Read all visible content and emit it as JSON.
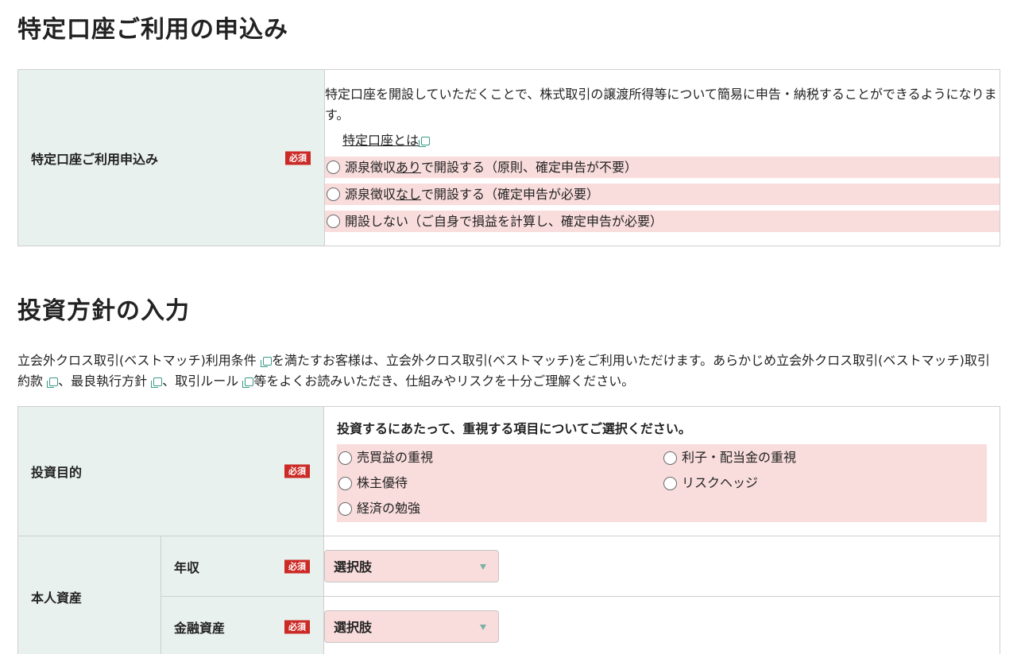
{
  "section1": {
    "title": "特定口座ご利用の申込み",
    "row_label": "特定口座ご利用申込み",
    "required": "必須",
    "description": "特定口座を開設していただくことで、株式取引の譲渡所得等について簡易に申告・納税することができるようになります。",
    "link_text": "特定口座とは",
    "options": [
      {
        "pre": "源泉徴収",
        "u": "あり",
        "post": "で開設する（原則、確定申告が不要）"
      },
      {
        "pre": "源泉徴収",
        "u": "なし",
        "post": "で開設する（確定申告が必要）"
      },
      {
        "pre": "開設しない（ご自身で損益を計算し、確定申告が必要）",
        "u": "",
        "post": ""
      }
    ]
  },
  "section2": {
    "title": "投資方針の入力",
    "para_1": "立会外クロス取引(ベストマッチ)利用条件",
    "para_2": "を満たすお客様は、立会外クロス取引(ベストマッチ)をご利用いただけます。あらかじめ立会外クロス取引(ベストマッチ)取引約款",
    "para_3": "、最良執行方針",
    "para_4": "、取引ルール",
    "para_5": "等をよくお読みいただき、仕組みやリスクを十分ご理解ください。",
    "goal": {
      "label": "投資目的",
      "required": "必須",
      "question": "投資するにあたって、重視する項目についてご選択ください。",
      "options": [
        "売買益の重視",
        "利子・配当金の重視",
        "株主優待",
        "リスクヘッジ",
        "経済の勉強"
      ]
    },
    "assets": {
      "label": "本人資産",
      "annual_income_label": "年収",
      "financial_assets_label": "金融資産",
      "required": "必須",
      "select_placeholder": "選択肢"
    }
  }
}
